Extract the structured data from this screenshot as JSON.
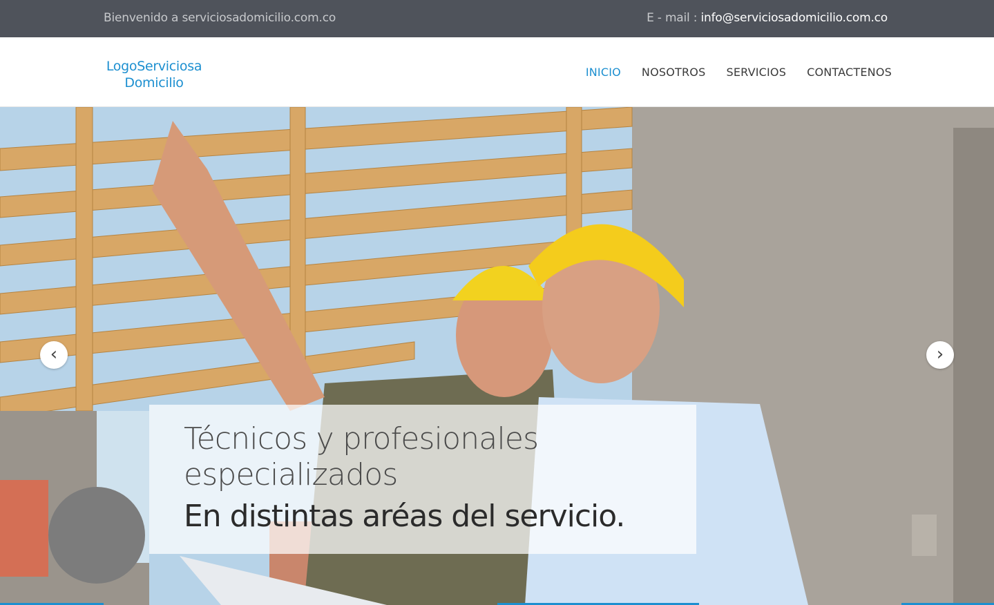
{
  "topbar": {
    "welcome": "Bienvenido a serviciosadomicilio.com.co",
    "email_label": "E - mail : ",
    "email": "info@serviciosadomicilio.com.co"
  },
  "header": {
    "logo_line1": "LogoServiciosa",
    "logo_line2": "Domicilio",
    "nav": [
      "INICIO",
      "NOSOTROS",
      "SERVICIOS",
      "CONTACTENOS"
    ],
    "active_nav": "INICIO"
  },
  "hero": {
    "headline": "Técnicos y profesionales especializados",
    "subheadline": "En distintas aréas del servicio.",
    "prev_glyph": "‹",
    "next_glyph": "›"
  },
  "colors": {
    "accent": "#1c8fd0",
    "topbar_bg": "#4f535b"
  }
}
